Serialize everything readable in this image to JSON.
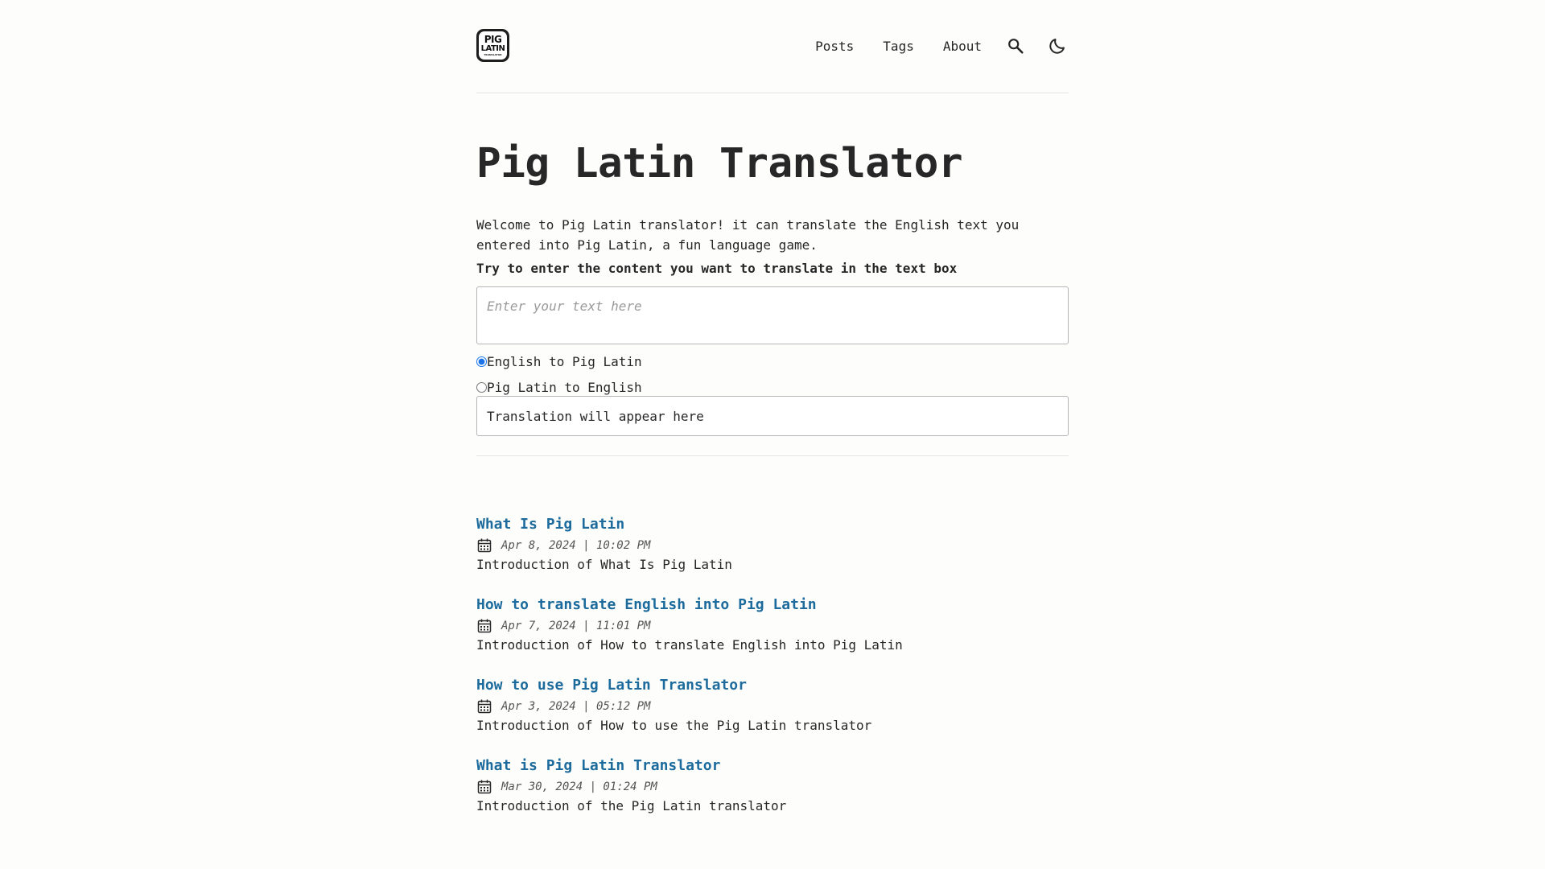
{
  "header": {
    "logo": {
      "line1": "PIG",
      "line2": "LATIN",
      "line3": "TRANSLATOR"
    },
    "nav": [
      {
        "label": "Posts"
      },
      {
        "label": "Tags"
      },
      {
        "label": "About"
      }
    ],
    "icons": [
      "search-icon",
      "moon-icon"
    ]
  },
  "main": {
    "title": "Pig Latin Translator",
    "intro": "Welcome to Pig Latin translator! it can translate the English text you entered into Pig Latin, a fun language game.",
    "instruction": "Try to enter the content you want to translate in the text box",
    "input": {
      "placeholder": "Enter your text here",
      "value": ""
    },
    "modes": [
      {
        "label": "English to Pig Latin",
        "checked": true
      },
      {
        "label": "Pig Latin to English",
        "checked": false
      }
    ],
    "output": "Translation will appear here"
  },
  "posts": [
    {
      "title": "What Is Pig Latin",
      "date": "Apr 8, 2024 | 10:02 PM",
      "description": "Introduction of What Is Pig Latin"
    },
    {
      "title": "How to translate English into Pig Latin",
      "date": "Apr 7, 2024 | 11:01 PM",
      "description": "Introduction of How to translate English into Pig Latin"
    },
    {
      "title": "How to use Pig Latin Translator",
      "date": "Apr 3, 2024 | 05:12 PM",
      "description": "Introduction of How to use the Pig Latin translator"
    },
    {
      "title": "What is Pig Latin Translator",
      "date": "Mar 30, 2024 | 01:24 PM",
      "description": "Introduction of the Pig Latin translator"
    }
  ],
  "colors": {
    "background": "#fdfdfc",
    "text": "#282728",
    "link": "#1c6b9c",
    "radio_accent": "#1a73e8"
  }
}
